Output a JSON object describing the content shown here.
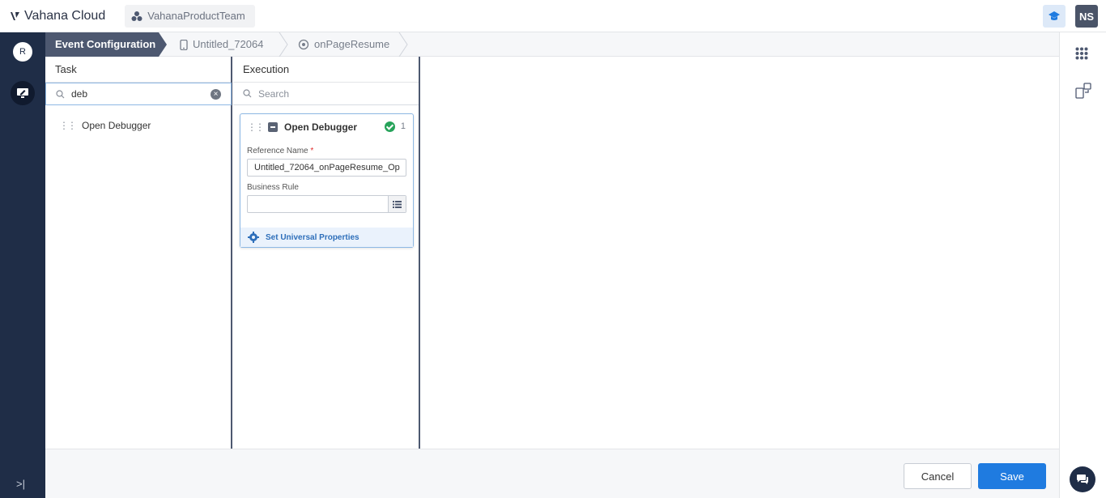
{
  "header": {
    "app_name": "Vahana Cloud",
    "team_name": "VahanaProductTeam",
    "user_initials": "NS"
  },
  "sidebar": {
    "user_initial": "R"
  },
  "breadcrumb": {
    "items": [
      {
        "label": "Event Configuration",
        "icon": "none",
        "active": true
      },
      {
        "label": "Untitled_72064",
        "icon": "phone-icon",
        "active": false
      },
      {
        "label": "onPageResume",
        "icon": "target-icon",
        "active": false
      }
    ]
  },
  "task_panel": {
    "title": "Task",
    "search_value": "deb",
    "items": [
      {
        "label": "Open Debugger"
      }
    ]
  },
  "execution_panel": {
    "title": "Execution",
    "search_placeholder": "Search",
    "card": {
      "title": "Open Debugger",
      "count": "1",
      "reference_label": "Reference Name",
      "required_mark": "*",
      "reference_value": "Untitled_72064_onPageResume_Op",
      "business_rule_label": "Business Rule",
      "business_rule_value": "",
      "universal_label": "Set Universal Properties"
    }
  },
  "footer": {
    "cancel_label": "Cancel",
    "save_label": "Save"
  },
  "colors": {
    "sidebar_bg": "#1f2d47",
    "primary": "#1f7be0",
    "active_crumb": "#4d5870",
    "success": "#27a35a"
  }
}
